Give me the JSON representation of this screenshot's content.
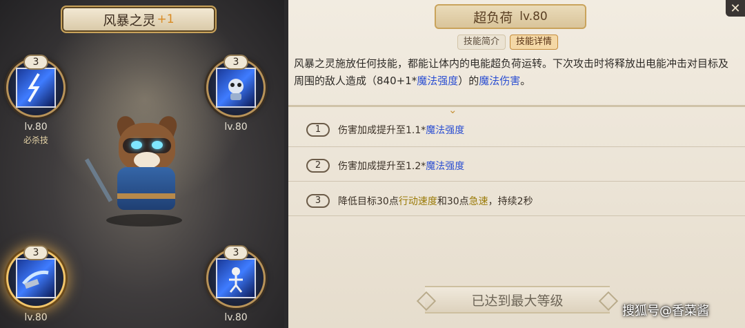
{
  "hero": {
    "name": "风暴之灵",
    "plus": "+1"
  },
  "skills": [
    {
      "level_badge": "3",
      "lv": "lv.80",
      "tag": "必杀技",
      "icon": "lightning-icon"
    },
    {
      "level_badge": "3",
      "lv": "lv.80",
      "tag": "",
      "icon": "panda-spirit-icon"
    },
    {
      "level_badge": "3",
      "lv": "lv.80",
      "tag": "",
      "icon": "lightning-burst-icon"
    },
    {
      "level_badge": "3",
      "lv": "lv.80",
      "tag": "",
      "icon": "skeleton-shock-icon"
    }
  ],
  "detail": {
    "skill_name": "超负荷",
    "skill_level": "lv.80",
    "tabs": [
      "技能简介",
      "技能详情"
    ],
    "active_tab": "技能详情",
    "desc_part1": "风暴之灵施放任何技能，都能让体内的电能超负荷运转。下次攻击时将释放出电能冲击对目标及周围的敌人造成（840+1*",
    "desc_hl1": "魔法强度",
    "desc_part2": "）的",
    "desc_hl2": "魔法伤害",
    "desc_part3": "。",
    "upgrades": [
      {
        "num": "1",
        "text": "伤害加成提升至1.1*",
        "hl": "魔法强度"
      },
      {
        "num": "2",
        "text": "伤害加成提升至1.2*",
        "hl": "魔法强度"
      },
      {
        "num": "3",
        "text_a": "降低目标30点",
        "hl_a": "行动速度",
        "text_b": "和30点",
        "hl_b": "急速",
        "text_c": "，持续2秒"
      }
    ],
    "max_label": "已达到最大等级"
  },
  "close_label": "✕",
  "watermark": "搜狐号@香菜酱",
  "colors": {
    "highlight_blue": "#2c4fd2",
    "highlight_gold": "#9a7a07",
    "accent_gold": "#c9a35b"
  }
}
